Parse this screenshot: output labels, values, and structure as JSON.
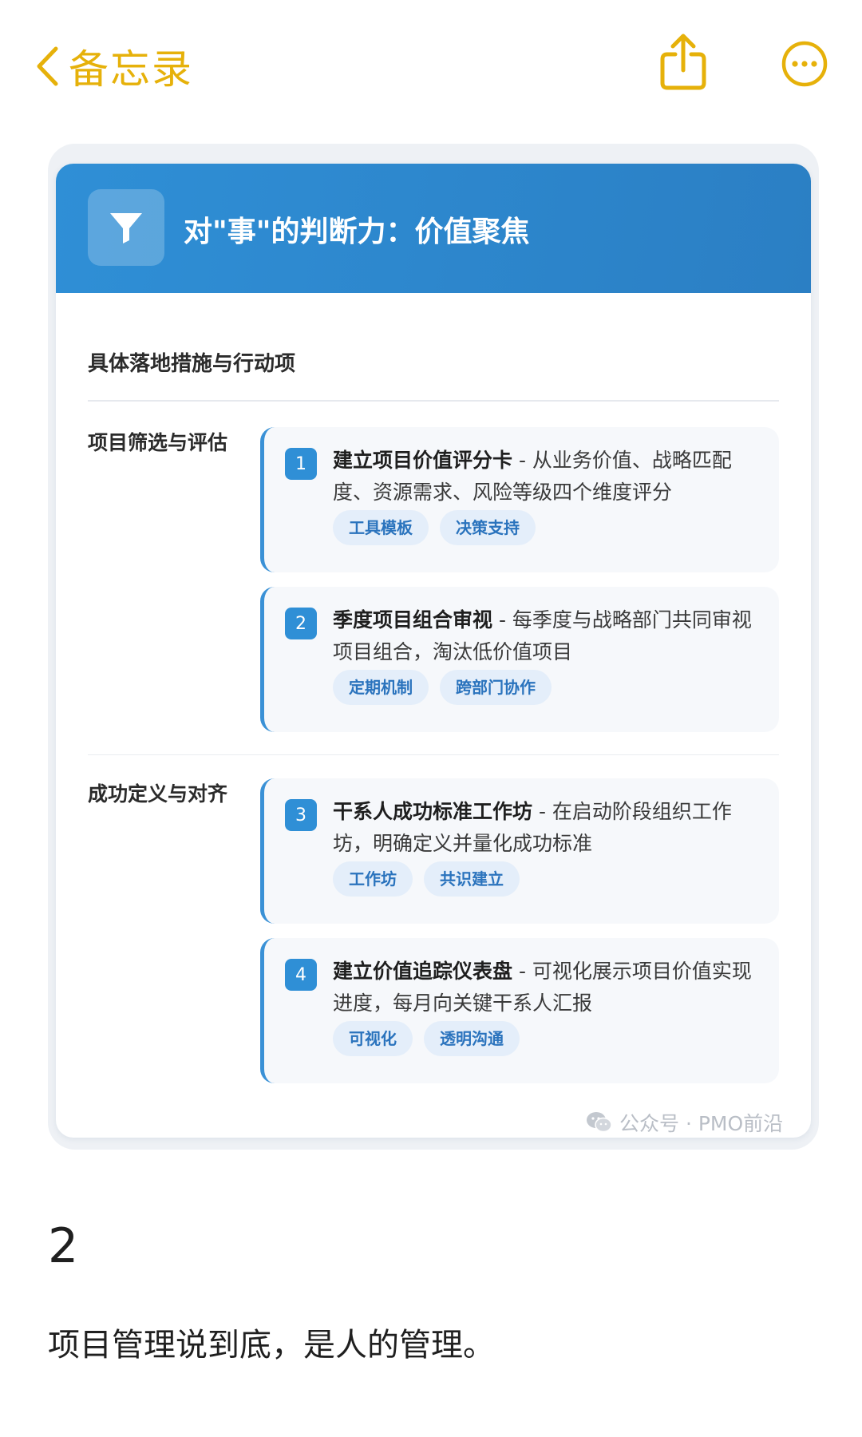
{
  "nav": {
    "back_label": "备忘录",
    "accent_color": "#e6b10a",
    "share_icon": "share-icon",
    "more_icon": "more-icon"
  },
  "card": {
    "header_title": "对\"事\"的判断力：价值聚焦",
    "header_icon": "filter-icon",
    "header_color": "#2f8fd6",
    "section_title": "具体落地措施与行动项",
    "groups": [
      {
        "label": "项目筛选与评估",
        "items": [
          {
            "number": "1",
            "title": "建立项目价值评分卡",
            "desc": " - 从业务价值、战略匹配度、资源需求、风险等级四个维度评分",
            "tags": [
              "工具模板",
              "决策支持"
            ]
          },
          {
            "number": "2",
            "title": "季度项目组合审视",
            "desc": " - 每季度与战略部门共同审视项目组合，淘汰低价值项目",
            "tags": [
              "定期机制",
              "跨部门协作"
            ]
          }
        ]
      },
      {
        "label": "成功定义与对齐",
        "items": [
          {
            "number": "3",
            "title": "干系人成功标准工作坊",
            "desc": " - 在启动阶段组织工作坊，明确定义并量化成功标准",
            "tags": [
              "工作坊",
              "共识建立"
            ]
          },
          {
            "number": "4",
            "title": "建立价值追踪仪表盘",
            "desc": " - 可视化展示项目价值实现进度，每月向关键干系人汇报",
            "tags": [
              "可视化",
              "透明沟通"
            ]
          }
        ]
      }
    ],
    "watermark": "公众号 · PMO前沿"
  },
  "note": {
    "number": "2",
    "text": "项目管理说到底，是人的管理。"
  }
}
